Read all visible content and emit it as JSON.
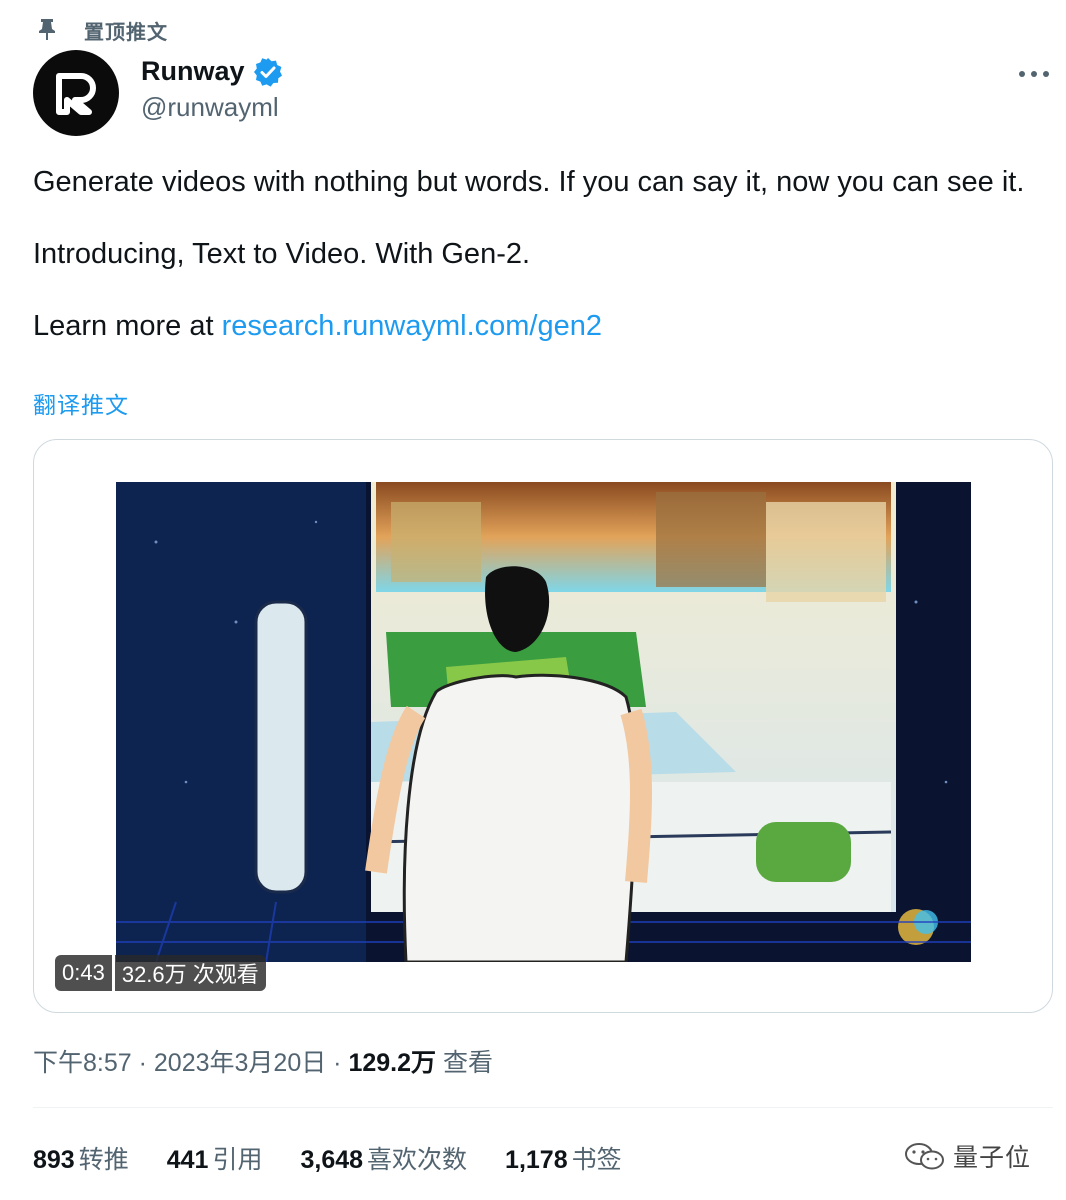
{
  "pinned": {
    "label": "置顶推文",
    "icon": "pin-icon"
  },
  "author": {
    "name": "Runway",
    "handle": "@runwayml",
    "verified": true,
    "avatar": "runway-logo"
  },
  "tweet": {
    "line1": "Generate videos with nothing but words. If you can say it, now you can see it.",
    "line2": "Introducing, Text to Video. With Gen-2.",
    "line3_prefix": "Learn more at ",
    "line3_link": "research.runwayml.com/gen2",
    "translate": "翻译推文"
  },
  "video": {
    "duration": "0:43",
    "views": "32.6万 次观看"
  },
  "meta": {
    "time": "下午8:57",
    "sep1": " · ",
    "date": "2023年3月20日",
    "sep2": " · ",
    "views_count": "129.2万",
    "views_label": " 查看"
  },
  "stats": [
    {
      "count": "893",
      "label": "转推"
    },
    {
      "count": "441",
      "label": "引用"
    },
    {
      "count": "3,648",
      "label": "喜欢次数"
    },
    {
      "count": "1,178",
      "label": "书签"
    }
  ],
  "watermark": {
    "text": "量子位",
    "icon": "wechat-icon"
  },
  "colors": {
    "link": "#1d9bf0",
    "secondary": "#536471",
    "verified": "#1d9bf0"
  }
}
